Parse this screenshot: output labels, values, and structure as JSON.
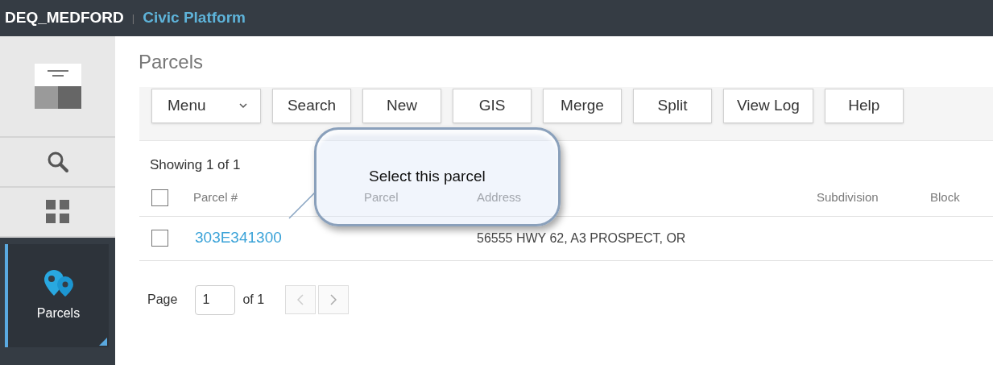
{
  "header": {
    "org": "DEQ_MEDFORD",
    "separator": "|",
    "product": "Civic Platform"
  },
  "sidebar": {
    "items": [
      {
        "kind": "logo",
        "selected": false
      },
      {
        "kind": "search",
        "selected": false
      },
      {
        "kind": "grid",
        "selected": false
      },
      {
        "kind": "parcels",
        "label": "Parcels",
        "selected": true
      }
    ]
  },
  "page": {
    "title": "Parcels"
  },
  "toolbar": {
    "menu": "Menu",
    "buttons": [
      "Search",
      "New",
      "GIS",
      "Merge",
      "Split",
      "View Log",
      "Help"
    ]
  },
  "table": {
    "summary": "Showing 1 of 1",
    "select_all_checked": false,
    "columns": [
      "Parcel #",
      "Parcel",
      "Address",
      "Subdivision",
      "Block"
    ],
    "rows": [
      {
        "checked": false,
        "cells": [
          "303E341300",
          "",
          "56555 HWY 62, A3 PROSPECT, OR",
          "",
          ""
        ]
      }
    ]
  },
  "pager": {
    "label": "Page",
    "value": "1",
    "of": "of 1"
  },
  "callout": {
    "text": "Select this parcel"
  }
}
